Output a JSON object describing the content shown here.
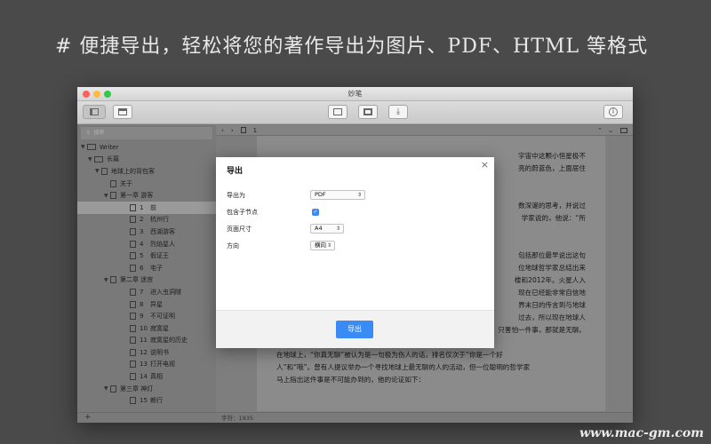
{
  "headline": "# 便捷导出，轻松将您的著作导出为图片、PDF、HTML 等格式",
  "window": {
    "title": "妙笔"
  },
  "sidebar": {
    "search_placeholder": "搜索",
    "items": [
      {
        "label": "Writer",
        "num": "",
        "kind": "folder",
        "arrow": "▼",
        "level": 0
      },
      {
        "label": "长篇",
        "num": "",
        "kind": "folder",
        "arrow": "▼",
        "level": 1
      },
      {
        "label": "地球上的背包客",
        "num": "",
        "kind": "doc",
        "arrow": "▼",
        "level": 2
      },
      {
        "label": "关于",
        "num": "",
        "kind": "doc",
        "arrow": "",
        "level": 3
      },
      {
        "label": "第一章  游客",
        "num": "",
        "kind": "doc",
        "arrow": "▼",
        "level": 3
      },
      {
        "label": "前",
        "num": "1",
        "kind": "doc",
        "arrow": "",
        "level": 4,
        "selected": true
      },
      {
        "label": "杭州行",
        "num": "2",
        "kind": "doc",
        "arrow": "",
        "level": 4
      },
      {
        "label": "西湖游客",
        "num": "3",
        "kind": "doc",
        "arrow": "",
        "level": 4
      },
      {
        "label": "烈焰星人",
        "num": "4",
        "kind": "doc",
        "arrow": "",
        "level": 4
      },
      {
        "label": "假证王",
        "num": "5",
        "kind": "doc",
        "arrow": "",
        "level": 4
      },
      {
        "label": "宅子",
        "num": "6",
        "kind": "doc",
        "arrow": "",
        "level": 4
      },
      {
        "label": "第二章  迷宫",
        "num": "",
        "kind": "doc",
        "arrow": "▼",
        "level": 3
      },
      {
        "label": "进入虫洞隧",
        "num": "7",
        "kind": "doc",
        "arrow": "",
        "level": 4
      },
      {
        "label": "异星",
        "num": "8",
        "kind": "doc",
        "arrow": "",
        "level": 4
      },
      {
        "label": "不可证明",
        "num": "9",
        "kind": "doc",
        "arrow": "",
        "level": 4
      },
      {
        "label": "寂寞星",
        "num": "10",
        "kind": "doc",
        "arrow": "",
        "level": 4
      },
      {
        "label": "寂寞星的历史",
        "num": "11",
        "kind": "doc",
        "arrow": "",
        "level": 4
      },
      {
        "label": "说明书",
        "num": "12",
        "kind": "doc",
        "arrow": "",
        "level": 4
      },
      {
        "label": "打开电视",
        "num": "13",
        "kind": "doc",
        "arrow": "",
        "level": 4
      },
      {
        "label": "真相",
        "num": "14",
        "kind": "doc",
        "arrow": "",
        "level": 4
      },
      {
        "label": "第三章  神灯",
        "num": "",
        "kind": "doc",
        "arrow": "▼",
        "level": 3
      },
      {
        "label": "赖行",
        "num": "15",
        "kind": "doc",
        "arrow": "",
        "level": 4
      }
    ],
    "add_label": "+"
  },
  "editor": {
    "page_num": "1",
    "word_count": "字符：1935",
    "lines": [
      "",
      "宇宙中这颗小恒星极不",
      "亮的蔚蓝色，上面居住",
      "",
      "",
      "数深邃的思考，并说过",
      "学家说的，他说：“所",
      "",
      "",
      "包括那位最早说出这句",
      "位地球哲学家总结出来",
      "楼和2012年。火星人入",
      "现在已经能非常自信地",
      "界末日的传言到与地球",
      "过去，所以现在地球人",
      "只害怕一件事，那就是无聊。",
      "",
      "在地球上，“你真无聊”被认为是一句极为伤人的话，排名仅次于“你是一个好",
      "人”和“哦”。曾有人提议举办一个寻找地球上最无聊的人的活动，但一位聪明的哲学家",
      "马上指出这件事是不可能办到的，他的论证如下："
    ]
  },
  "dialog": {
    "title": "导出",
    "close": "×",
    "export_as_label": "导出为",
    "export_as_value": "PDF",
    "include_children_label": "包含子节点",
    "include_children_checked": true,
    "page_size_label": "页面尺寸",
    "page_size_value": "A4",
    "orientation_label": "方向",
    "orientation_value": "横向",
    "export_button": "导出"
  },
  "watermark": "www.mac-gm.com",
  "colors": {
    "accent": "#3a8bf6",
    "background": "#4a4a4a"
  }
}
